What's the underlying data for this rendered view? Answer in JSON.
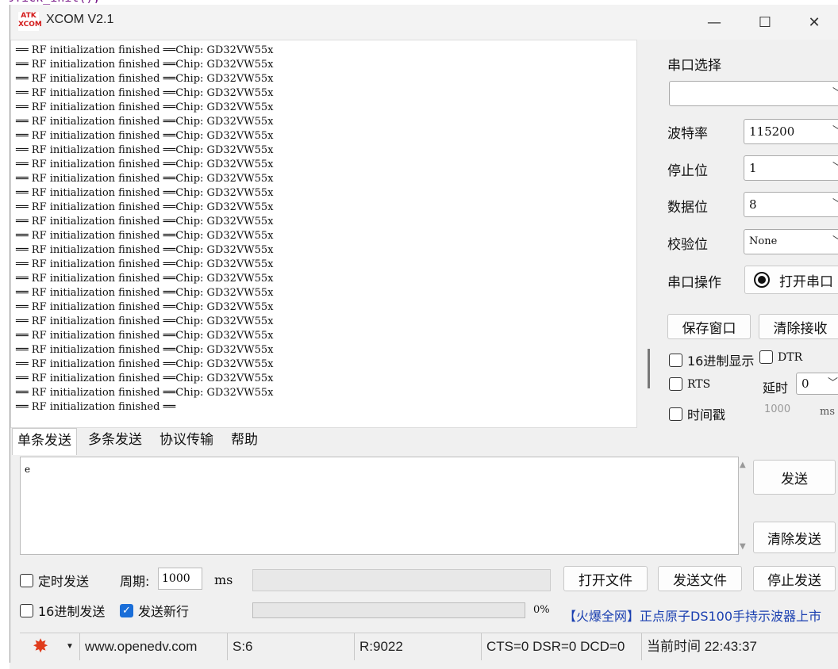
{
  "window": {
    "title": "XCOM V2.1",
    "logo_top": "ATK",
    "logo_bottom": "XCOM",
    "minimize": "—",
    "maximize": "☐",
    "close": "✕"
  },
  "receive": {
    "lines": [
      "══ RF initialization finished ══Chip: GD32VW55x",
      "══ RF initialization finished ══Chip: GD32VW55x",
      "══ RF initialization finished ══Chip: GD32VW55x",
      "══ RF initialization finished ══Chip: GD32VW55x",
      "══ RF initialization finished ══Chip: GD32VW55x",
      "══ RF initialization finished ══Chip: GD32VW55x",
      "══ RF initialization finished ══Chip: GD32VW55x",
      "══ RF initialization finished ══Chip: GD32VW55x",
      "══ RF initialization finished ══Chip: GD32VW55x",
      "══ RF initialization finished ══Chip: GD32VW55x",
      "══ RF initialization finished ══Chip: GD32VW55x",
      "══ RF initialization finished ══Chip: GD32VW55x",
      "══ RF initialization finished ══Chip: GD32VW55x",
      "══ RF initialization finished ══Chip: GD32VW55x",
      "══ RF initialization finished ══Chip: GD32VW55x",
      "══ RF initialization finished ══Chip: GD32VW55x",
      "══ RF initialization finished ══Chip: GD32VW55x",
      "══ RF initialization finished ══Chip: GD32VW55x",
      "══ RF initialization finished ══Chip: GD32VW55x",
      "══ RF initialization finished ══Chip: GD32VW55x",
      "══ RF initialization finished ══Chip: GD32VW55x",
      "══ RF initialization finished ══Chip: GD32VW55x",
      "══ RF initialization finished ══Chip: GD32VW55x",
      "══ RF initialization finished ══Chip: GD32VW55x",
      "══ RF initialization finished ══Chip: GD32VW55x",
      "══ RF initialization finished ══"
    ]
  },
  "settings": {
    "port_label": "串口选择",
    "port_value": "",
    "baud_label": "波特率",
    "baud_value": "115200",
    "stop_label": "停止位",
    "stop_value": "1",
    "data_label": "数据位",
    "data_value": "8",
    "parity_label": "校验位",
    "parity_value": "None",
    "op_label": "串口操作",
    "open_button": "打开串口",
    "save_button": "保存窗口",
    "clear_recv_button": "清除接收",
    "hex_display": "16进制显示",
    "dtr": "DTR",
    "rts": "RTS",
    "delay_label": "延时",
    "delay_value": "0",
    "timestamp": "时间戳",
    "timestamp_value": "1000",
    "timestamp_unit": "ms"
  },
  "tabs": [
    "单条发送",
    "多条发送",
    "协议传输",
    "帮助"
  ],
  "send": {
    "text": "e",
    "send_button": "发送",
    "clear_send_button": "清除发送",
    "timed_send": "定时发送",
    "period_label": "周期:",
    "period_value": "1000",
    "period_unit": "ms",
    "open_file": "打开文件",
    "send_file": "发送文件",
    "stop_send": "停止发送",
    "hex_send": "16进制发送",
    "newline": "发送新行",
    "progress": "0%",
    "ad": "【火爆全网】正点原子DS100手持示波器上市"
  },
  "status": {
    "url": "www.openedv.com",
    "sent": "S:6",
    "received": "R:9022",
    "lines": "CTS=0 DSR=0 DCD=0",
    "time": "当前时间 22:43:37"
  },
  "colors": {
    "accent": "#1a6ed8",
    "gear": "#e03c1c",
    "ad": "#1a3fb0"
  }
}
